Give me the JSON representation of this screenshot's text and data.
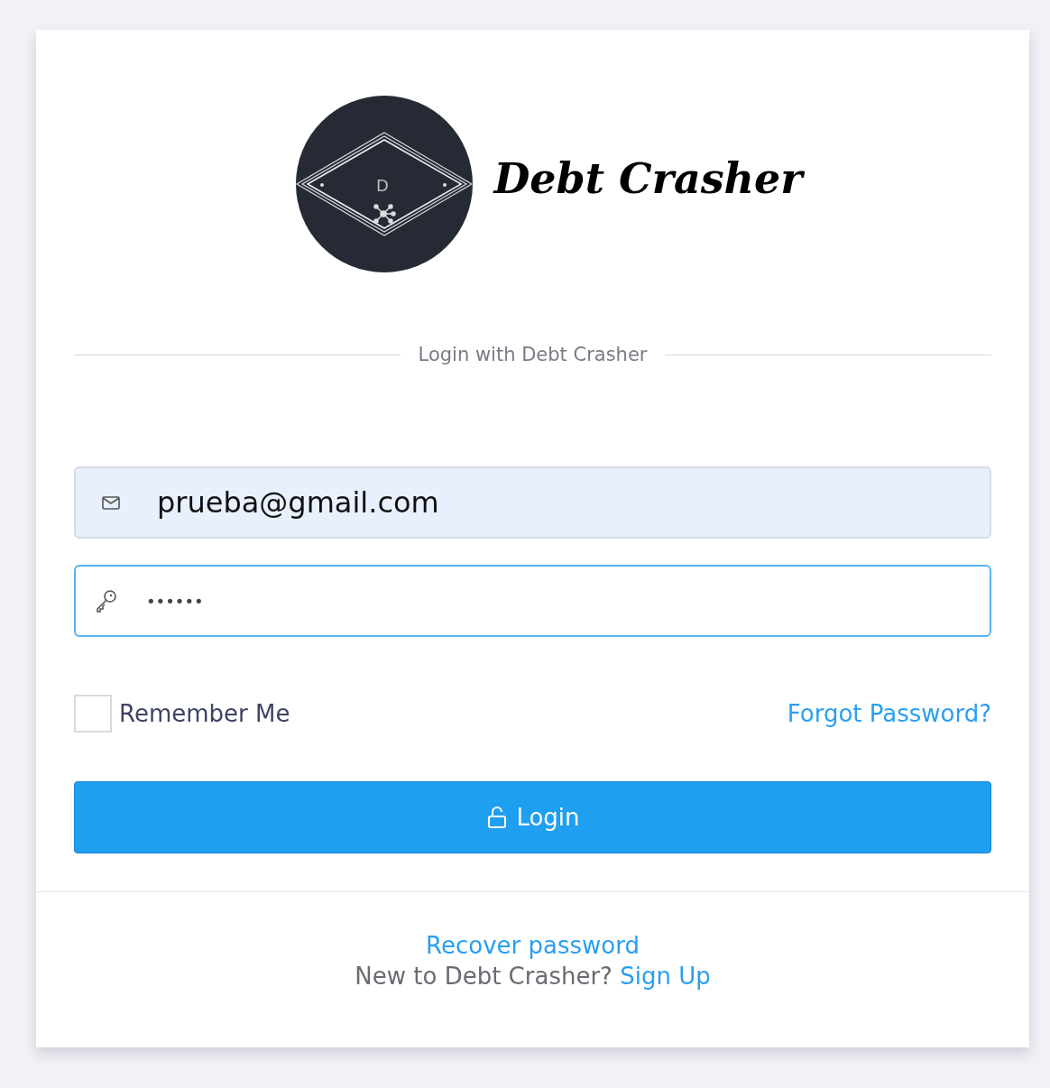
{
  "logo": {
    "letter": "D",
    "title": "Debt Crasher"
  },
  "divider_label": "Login with Debt Crasher",
  "fields": [
    {
      "kind": "email",
      "value": "prueba@gmail.com",
      "focused": false,
      "autofilled": true
    },
    {
      "kind": "password",
      "value": "••••••",
      "focused": true,
      "autofilled": false
    }
  ],
  "remember": {
    "label": "Remember Me",
    "checked": false
  },
  "forgot_link": "Forgot Password?",
  "login_button": "Login",
  "footer": {
    "recover_link": "Recover password",
    "signup_text": "New to Debt Crasher?",
    "signup_link": "Sign Up"
  }
}
